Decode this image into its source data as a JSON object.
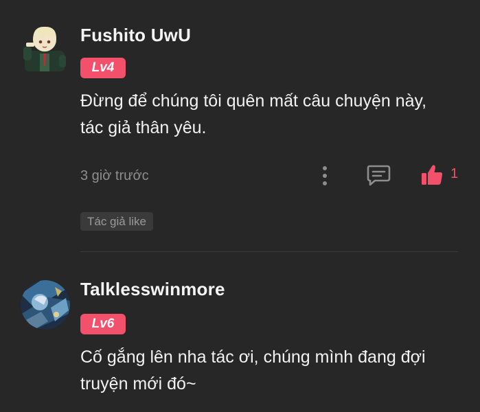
{
  "comments": [
    {
      "username": "Fushito UwU",
      "level": "Lv4",
      "text_lines": [
        "Đừng để chúng tôi quên mất câu chuyện này,",
        "tác giả thân yêu."
      ],
      "timestamp": "3 giờ trước",
      "like_count": "1",
      "author_tag": "Tác giả like"
    },
    {
      "username": "Talklesswinmore",
      "level": "Lv6",
      "text_lines": [
        "Cố gắng lên nha tác ơi, chúng mình đang đợi",
        "truyện mới đó~"
      ]
    }
  ],
  "icons": {
    "more": "more-vertical-icon",
    "reply": "reply-comment-icon",
    "like": "thumbs-up-icon"
  },
  "colors": {
    "background": "#272727",
    "accent": "#f2506b",
    "muted_text": "#8e8e8e",
    "primary_text": "#f2f2f2"
  }
}
